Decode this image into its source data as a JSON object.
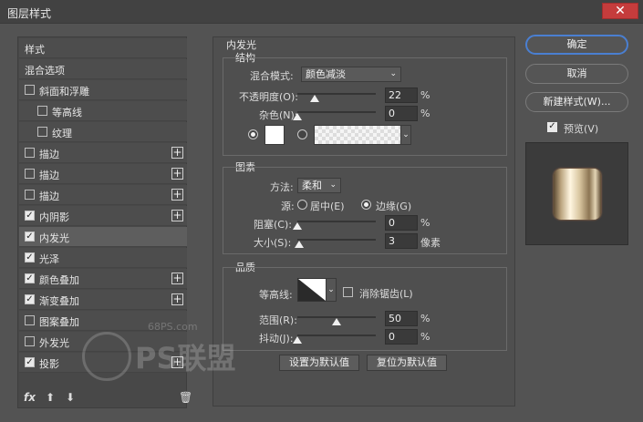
{
  "window": {
    "title": "图层样式",
    "close_icon": "close-icon"
  },
  "styles_list": [
    {
      "label": "样式",
      "checkbox": false,
      "checked": false,
      "plus": false,
      "indent": 0
    },
    {
      "label": "混合选项",
      "checkbox": false,
      "checked": false,
      "plus": false,
      "indent": 0
    },
    {
      "label": "斜面和浮雕",
      "checkbox": true,
      "checked": false,
      "plus": false,
      "indent": 0
    },
    {
      "label": "等高线",
      "checkbox": true,
      "checked": false,
      "plus": false,
      "indent": 1
    },
    {
      "label": "纹理",
      "checkbox": true,
      "checked": false,
      "plus": false,
      "indent": 1
    },
    {
      "label": "描边",
      "checkbox": true,
      "checked": false,
      "plus": true,
      "indent": 0
    },
    {
      "label": "描边",
      "checkbox": true,
      "checked": false,
      "plus": true,
      "indent": 0
    },
    {
      "label": "描边",
      "checkbox": true,
      "checked": false,
      "plus": true,
      "indent": 0
    },
    {
      "label": "内阴影",
      "checkbox": true,
      "checked": true,
      "plus": true,
      "indent": 0
    },
    {
      "label": "内发光",
      "checkbox": true,
      "checked": true,
      "plus": false,
      "indent": 0,
      "selected": true
    },
    {
      "label": "光泽",
      "checkbox": true,
      "checked": true,
      "plus": false,
      "indent": 0
    },
    {
      "label": "颜色叠加",
      "checkbox": true,
      "checked": true,
      "plus": true,
      "indent": 0
    },
    {
      "label": "渐变叠加",
      "checkbox": true,
      "checked": true,
      "plus": true,
      "indent": 0
    },
    {
      "label": "图案叠加",
      "checkbox": true,
      "checked": false,
      "plus": false,
      "indent": 0
    },
    {
      "label": "外发光",
      "checkbox": true,
      "checked": false,
      "plus": false,
      "indent": 0
    },
    {
      "label": "投影",
      "checkbox": true,
      "checked": true,
      "plus": true,
      "indent": 0
    }
  ],
  "bottom_tools": {
    "fx": "fx",
    "up": "⬆",
    "down": "⬇",
    "trash": "🗑"
  },
  "inner_glow": {
    "title": "内发光",
    "structure": {
      "title": "结构",
      "blend_mode_label": "混合模式:",
      "blend_mode_value": "颜色减淡",
      "opacity_label": "不透明度(O):",
      "opacity_value": "22",
      "opacity_unit": "%",
      "opacity_level": 0.22,
      "noise_label": "杂色(N):",
      "noise_value": "0",
      "noise_unit": "%",
      "noise_level": 0
    },
    "elements": {
      "title": "图素",
      "method_label": "方法:",
      "method_value": "柔和",
      "source_label": "源:",
      "source_center": "居中(E)",
      "source_edge": "边缘(G)",
      "choke_label": "阻塞(C):",
      "choke_value": "0",
      "choke_unit": "%",
      "choke_level": 0,
      "size_label": "大小(S):",
      "size_value": "3",
      "size_unit": "像素",
      "size_level": 0.02
    },
    "quality": {
      "title": "品质",
      "contour_label": "等高线:",
      "antialias_label": "消除锯齿(L)",
      "range_label": "范围(R):",
      "range_value": "50",
      "range_unit": "%",
      "range_level": 0.5,
      "jitter_label": "抖动(J):",
      "jitter_value": "0",
      "jitter_unit": "%",
      "jitter_level": 0
    },
    "set_default": "设置为默认值",
    "reset_default": "复位为默认值"
  },
  "buttons": {
    "ok": "确定",
    "cancel": "取消",
    "new_style": "新建样式(W)...",
    "preview": "预览(V)"
  },
  "watermark": {
    "site": "68PS.com",
    "text": "PS联盟"
  }
}
